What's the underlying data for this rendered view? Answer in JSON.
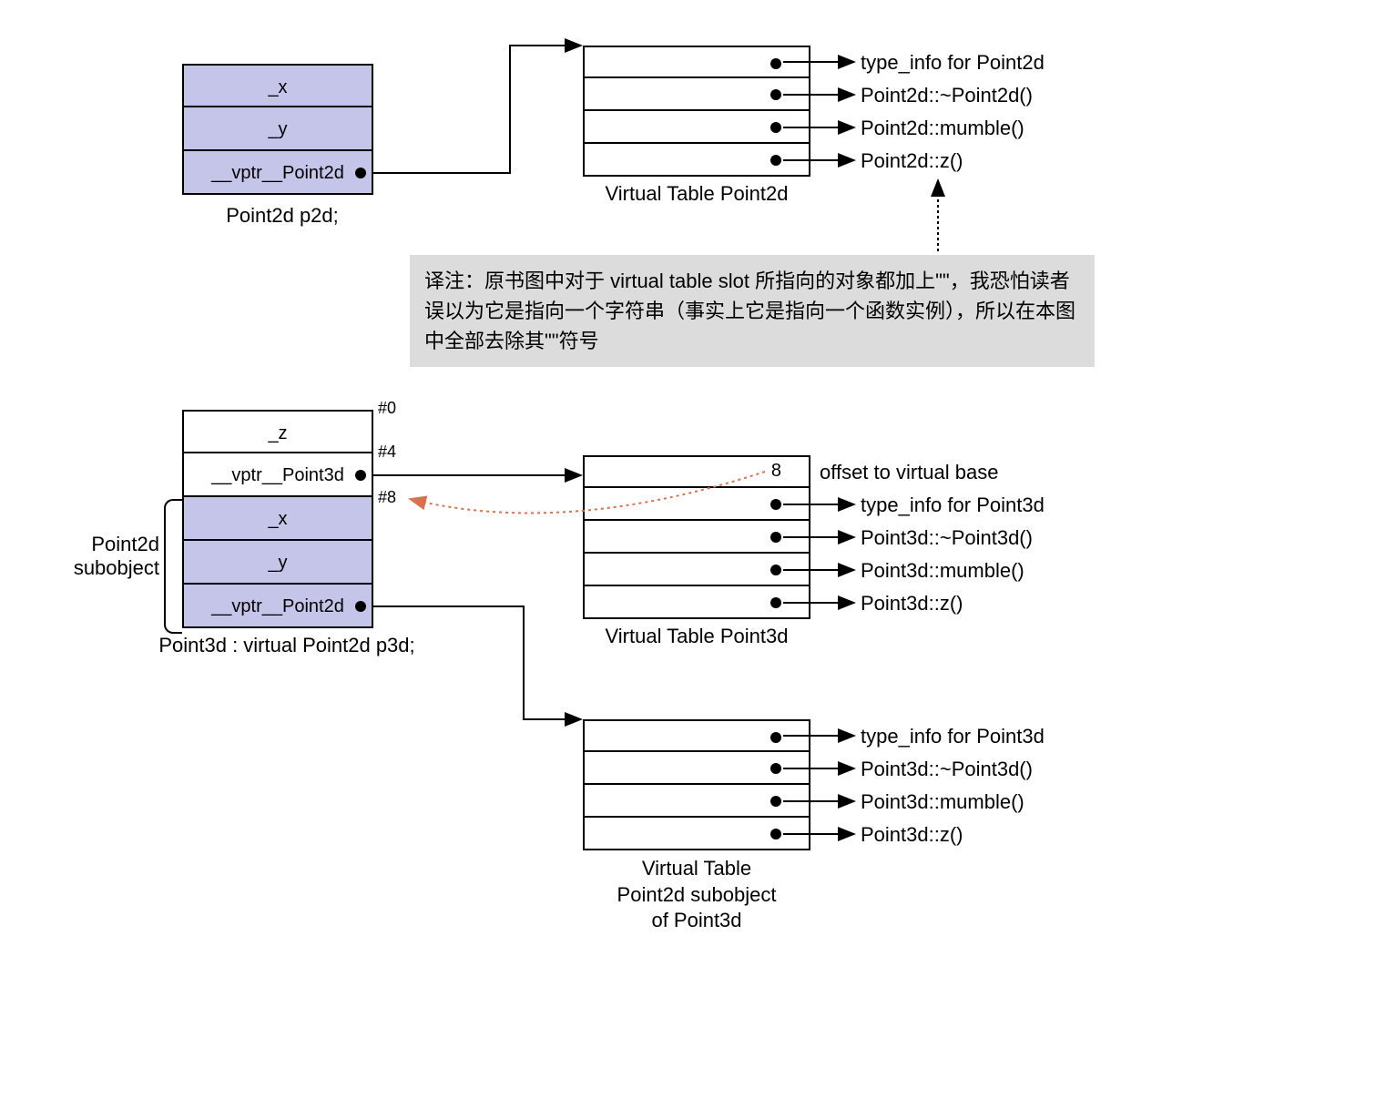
{
  "point2d_object": {
    "rows": [
      "_x",
      "_y",
      "__vptr__Point2d"
    ],
    "caption": "Point2d  p2d;"
  },
  "vtable_2d": {
    "caption": "Virtual Table Point2d",
    "entries": [
      "type_info for Point2d",
      "Point2d::~Point2d()",
      "Point2d::mumble()",
      "Point2d::z()"
    ]
  },
  "note": "译注：原书图中对于 virtual table slot 所指向的对象都加上\"\"，我恐怕读者误以为它是指向一个字符串（事实上它是指向一个函数实例），所以在本图中全部去除其\"\"符号",
  "point3d_object": {
    "rows": [
      "_z",
      "__vptr__Point3d",
      "_x",
      "_y",
      "__vptr__Point2d"
    ],
    "offsets": [
      "#0",
      "#4",
      "#8"
    ],
    "caption": "Point3d : virtual Point2d  p3d;",
    "subobject_label": "Point2d\nsubobject"
  },
  "vtable_3d": {
    "caption": "Virtual Table Point3d",
    "offset_value": "8",
    "entries": [
      "offset to virtual base",
      "type_info for Point3d",
      "Point3d::~Point3d()",
      "Point3d::mumble()",
      "Point3d::z()"
    ]
  },
  "vtable_3d_sub": {
    "caption": "Virtual Table\nPoint2d subobject\nof Point3d",
    "entries": [
      "type_info for Point3d",
      "Point3d::~Point3d()",
      "Point3d::mumble()",
      "Point3d::z()"
    ]
  }
}
